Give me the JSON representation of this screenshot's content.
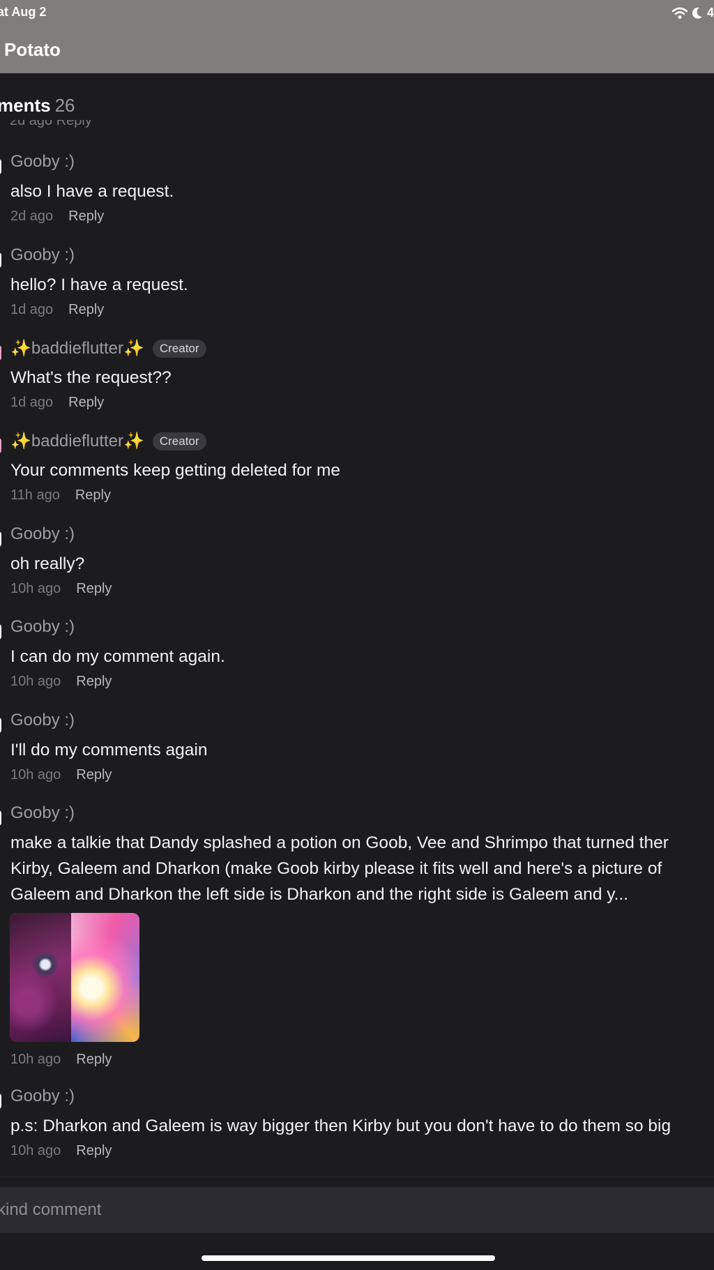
{
  "status_bar": {
    "date": "at Aug 2",
    "battery_fragment": "4"
  },
  "header": {
    "title": "Potato"
  },
  "comments_section": {
    "heading": "ments",
    "count": "26"
  },
  "comments": [
    {
      "author": "Gooby :)",
      "creator": false,
      "text": [
        "also I have a request."
      ],
      "time": "2d ago",
      "reply_label": "Reply"
    },
    {
      "author": "Gooby :)",
      "creator": false,
      "text": [
        "hello? I have a request."
      ],
      "time": "1d ago",
      "reply_label": "Reply"
    },
    {
      "author": "✨baddieflutter✨",
      "creator": true,
      "badge": "Creator",
      "text": [
        "What's the request??"
      ],
      "time": "1d ago",
      "reply_label": "Reply"
    },
    {
      "author": "✨baddieflutter✨",
      "creator": true,
      "badge": "Creator",
      "text": [
        "Your comments keep getting deleted for me"
      ],
      "time": "11h ago",
      "reply_label": "Reply"
    },
    {
      "author": "Gooby :)",
      "creator": false,
      "text": [
        "oh really?"
      ],
      "time": "10h ago",
      "reply_label": "Reply"
    },
    {
      "author": "Gooby :)",
      "creator": false,
      "text": [
        "I can do my comment again."
      ],
      "time": "10h ago",
      "reply_label": "Reply"
    },
    {
      "author": "Gooby :)",
      "creator": false,
      "text": [
        "I'll do my comments again"
      ],
      "time": "10h ago",
      "reply_label": "Reply"
    },
    {
      "author": "Gooby :)",
      "creator": false,
      "text": [
        "make a talkie that Dandy splashed a potion on Goob, Vee and Shrimpo that turned ther",
        "Kirby, Galeem and Dharkon (make Goob kirby please it fits well and here's a picture of",
        "Galeem and Dharkon the left side is Dharkon and the right side is Galeem and y..."
      ],
      "has_image": true,
      "time": "10h ago",
      "reply_label": "Reply"
    },
    {
      "author": "Gooby :)",
      "creator": false,
      "text": [
        "p.s: Dharkon and Galeem is way bigger then Kirby but you don't have to do them so big"
      ],
      "time": "10h ago",
      "reply_label": "Reply"
    }
  ],
  "input": {
    "placeholder": "kind comment"
  }
}
